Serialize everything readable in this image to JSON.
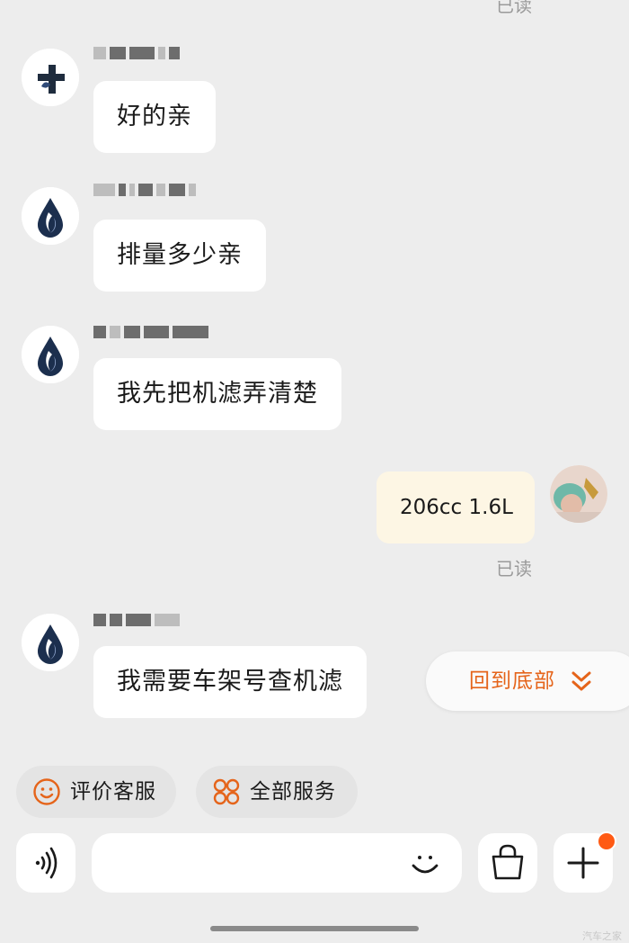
{
  "top_read_status": "已读",
  "messages": [
    {
      "from": "shop",
      "text": "好的亲"
    },
    {
      "from": "shop",
      "text": "排量多少亲"
    },
    {
      "from": "shop",
      "text": "我先把机滤弄清楚"
    },
    {
      "from": "me",
      "text": "206cc 1.6L",
      "status": "已读"
    },
    {
      "from": "shop",
      "text": "我需要车架号查机滤"
    }
  ],
  "scroll_to_bottom_label": "回到底部",
  "quick_actions": [
    {
      "label": "评价客服",
      "icon": "smiley-icon"
    },
    {
      "label": "全部服务",
      "icon": "services-grid-icon"
    }
  ],
  "input_bar": {
    "voice_icon": "voice-icon",
    "emoji_icon": "emoji-icon",
    "shop_icon": "shopping-bag-icon",
    "plus_icon": "plus-icon",
    "accent_color": "#ff5a14"
  },
  "watermark": "汽车之家"
}
